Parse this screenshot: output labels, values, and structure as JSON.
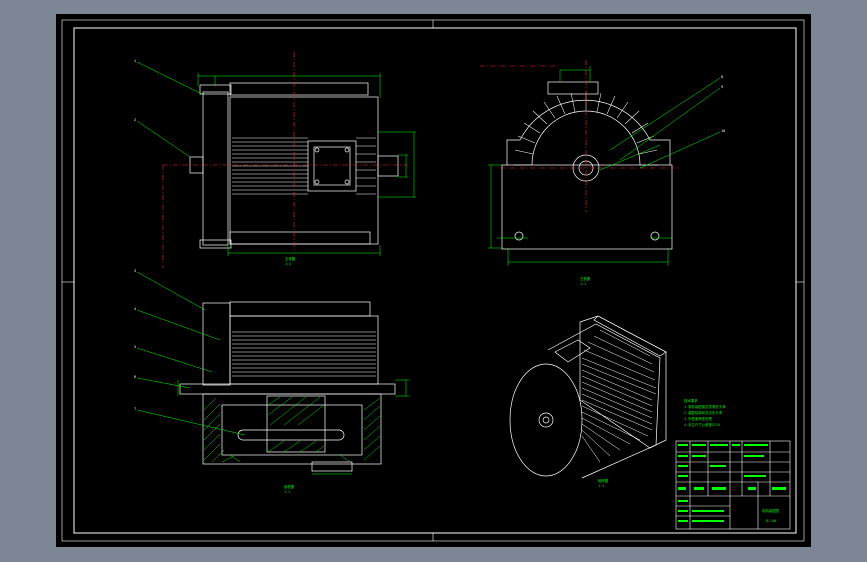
{
  "colors": {
    "background": "#7d8695",
    "sheet": "#000000",
    "border": "#ffffff",
    "outline": "#ffffff",
    "dimension": "#00ff00",
    "centerline": "#ff2b2b",
    "leader": "#00ff00"
  },
  "views": {
    "front": {
      "title": "主视图",
      "scale": "1:1"
    },
    "side": {
      "title": "左视图",
      "scale": "1:1"
    },
    "section": {
      "title": "剖视图",
      "scale": "1:1"
    },
    "iso": {
      "title": "轴测图",
      "scale": "1:1"
    }
  },
  "notes": {
    "heading": "技术要求",
    "lines": [
      "1.零件装配前必须清洗干净",
      "2.装配后转动灵活无卡滞",
      "3.外表面喷漆处理",
      "4.未注尺寸公差按IT14"
    ]
  },
  "title_block": {
    "drawing_name": "电机装配图",
    "drawing_no": "DJ-00"
  }
}
